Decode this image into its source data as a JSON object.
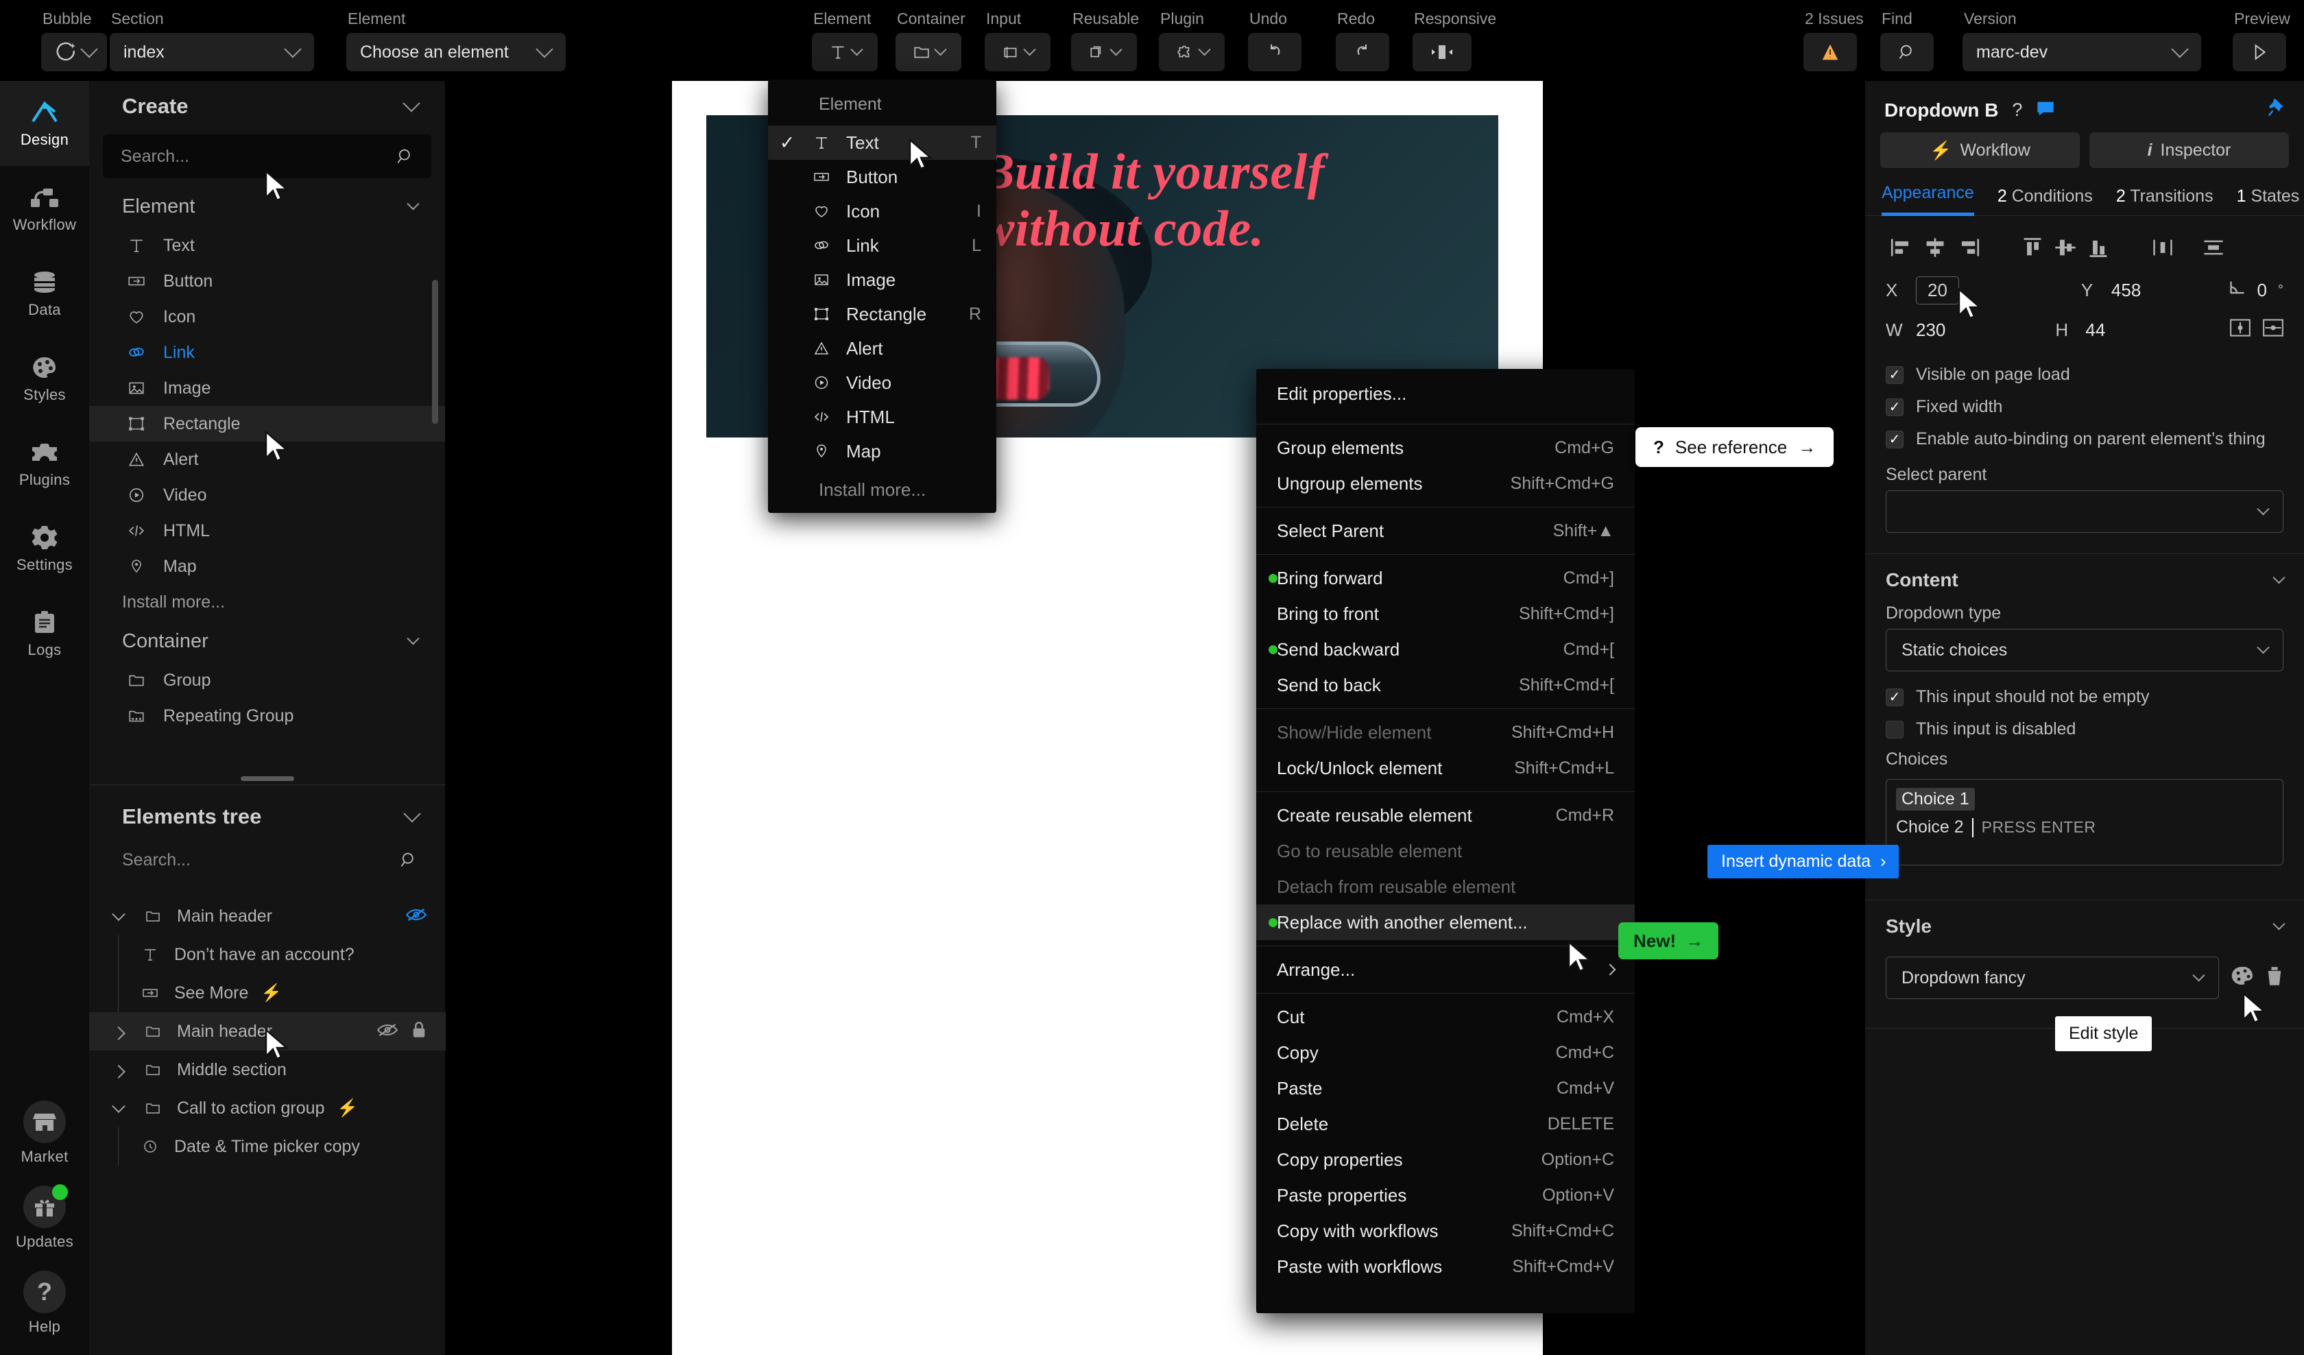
{
  "topbar": {
    "groups": [
      {
        "label": "Bubble",
        "type": "logo"
      },
      {
        "label": "Section",
        "type": "select",
        "value": "index"
      },
      {
        "label": "Element",
        "type": "select",
        "value": "Choose an element"
      },
      {
        "label": "Element",
        "type": "icon",
        "icon": "text-T-icon"
      },
      {
        "label": "Container",
        "type": "icon",
        "icon": "folder-icon"
      },
      {
        "label": "Input",
        "type": "icon",
        "icon": "input-box-icon"
      },
      {
        "label": "Reusable",
        "type": "icon",
        "icon": "stacked-layers-icon"
      },
      {
        "label": "Plugin",
        "type": "icon",
        "icon": "puzzle-icon"
      },
      {
        "label": "Undo",
        "type": "icon",
        "icon": "undo-arrow-icon"
      },
      {
        "label": "Redo",
        "type": "icon",
        "icon": "redo-arrow-icon"
      },
      {
        "label": "Responsive",
        "type": "icon",
        "icon": "responsive-icon"
      },
      {
        "label": "2 Issues",
        "type": "icon",
        "icon": "warning-triangle-icon"
      },
      {
        "label": "Find",
        "type": "icon",
        "icon": "magnifier-icon"
      },
      {
        "label": "Version",
        "type": "select",
        "value": "marc-dev"
      },
      {
        "label": "Preview",
        "type": "icon",
        "icon": "play-triangle-icon"
      }
    ]
  },
  "rail": {
    "items": [
      {
        "label": "Design",
        "icon": "compass-icon",
        "active": true
      },
      {
        "label": "Workflow",
        "icon": "workflow-icon",
        "active": false
      },
      {
        "label": "Data",
        "icon": "database-icon",
        "active": false
      },
      {
        "label": "Styles",
        "icon": "palette-icon",
        "active": false
      },
      {
        "label": "Plugins",
        "icon": "plugin-puzzle-icon",
        "active": false
      },
      {
        "label": "Settings",
        "icon": "gear-icon",
        "active": false
      },
      {
        "label": "Logs",
        "icon": "clipboard-icon",
        "active": false
      }
    ],
    "bottom": [
      {
        "label": "Market",
        "icon": "store-icon",
        "badge": false
      },
      {
        "label": "Updates",
        "icon": "gift-icon",
        "badge": true
      },
      {
        "label": "Help",
        "icon": "question-mark-icon",
        "badge": false
      }
    ]
  },
  "left_panel": {
    "create_title": "Create",
    "search_placeholder": "Search...",
    "element_group": "Element",
    "element_items": [
      {
        "label": "Text",
        "icon": "text-T-icon"
      },
      {
        "label": "Button",
        "icon": "button-icon"
      },
      {
        "label": "Icon",
        "icon": "heart-icon"
      },
      {
        "label": "Link",
        "icon": "link-icon",
        "highlight_blue": true
      },
      {
        "label": "Image",
        "icon": "image-icon"
      },
      {
        "label": "Rectangle",
        "icon": "rectangle-icon",
        "hovered": true
      },
      {
        "label": "Alert",
        "icon": "alert-triangle-icon"
      },
      {
        "label": "Video",
        "icon": "video-play-icon"
      },
      {
        "label": "HTML",
        "icon": "code-icon"
      },
      {
        "label": "Map",
        "icon": "map-pin-icon"
      }
    ],
    "install_more": "Install more...",
    "container_group": "Container",
    "container_items": [
      {
        "label": "Group",
        "icon": "folder-icon"
      },
      {
        "label": "Repeating Group",
        "icon": "repeating-folder-icon"
      }
    ],
    "tree_title": "Elements tree",
    "tree_search_placeholder": "Search...",
    "tree": [
      {
        "label": "Main header",
        "icon": "folder-icon",
        "expanded": true,
        "depth": 0,
        "eye": "hidden-blue",
        "lock": false,
        "bolt": false
      },
      {
        "label": "Don’t have an account?",
        "icon": "text-T-icon",
        "depth": 1,
        "bolt": false
      },
      {
        "label": "See More",
        "icon": "button-icon",
        "depth": 1,
        "bolt": true
      },
      {
        "label": "Main header",
        "icon": "folder-icon",
        "collapsed": true,
        "depth": 0,
        "eye": "hidden-grey",
        "lock": true,
        "selected": true,
        "bolt": false
      },
      {
        "label": "Middle section",
        "icon": "folder-icon",
        "collapsed": true,
        "depth": 0,
        "bolt": false
      },
      {
        "label": "Call to action group",
        "icon": "folder-icon",
        "expanded": true,
        "depth": 0,
        "bolt": true
      },
      {
        "label": "Date & Time picker copy",
        "icon": "clock-icon",
        "depth": 1,
        "bolt": false
      }
    ]
  },
  "canvas": {
    "hero_heading": "Build it yourself without code."
  },
  "element_menu": {
    "title": "Element",
    "items": [
      {
        "label": "Text",
        "key": "T",
        "icon": "text-T-icon",
        "checked": true
      },
      {
        "label": "Button",
        "key": "",
        "icon": "button-icon"
      },
      {
        "label": "Icon",
        "key": "I",
        "icon": "heart-icon"
      },
      {
        "label": "Link",
        "key": "L",
        "icon": "link-icon"
      },
      {
        "label": "Image",
        "key": "",
        "icon": "image-icon"
      },
      {
        "label": "Rectangle",
        "key": "R",
        "icon": "rectangle-icon"
      },
      {
        "label": "Alert",
        "key": "",
        "icon": "alert-triangle-icon"
      },
      {
        "label": "Video",
        "key": "",
        "icon": "video-play-icon"
      },
      {
        "label": "HTML",
        "key": "",
        "icon": "code-icon"
      },
      {
        "label": "Map",
        "key": "",
        "icon": "map-pin-icon"
      }
    ],
    "install_more": "Install more..."
  },
  "context_menu": {
    "items": [
      {
        "label": "Edit properties...",
        "key": "",
        "sep_after": true
      },
      {
        "label": "Group elements",
        "key": "Cmd+G"
      },
      {
        "label": "Ungroup elements",
        "key": "Shift+Cmd+G",
        "sep_after": true
      },
      {
        "label": "Select Parent",
        "key": "Shift+▲",
        "sep_after": true
      },
      {
        "label": "Bring forward",
        "key": "Cmd+]",
        "dot": true
      },
      {
        "label": "Bring to front",
        "key": "Shift+Cmd+]"
      },
      {
        "label": "Send backward",
        "key": "Cmd+[",
        "dot": true
      },
      {
        "label": "Send to back",
        "key": "Shift+Cmd+[",
        "sep_after": true
      },
      {
        "label": "Show/Hide element",
        "key": "Shift+Cmd+H",
        "disabled": true
      },
      {
        "label": "Lock/Unlock element",
        "key": "Shift+Cmd+L",
        "sep_after": true
      },
      {
        "label": "Create reusable element",
        "key": "Cmd+R"
      },
      {
        "label": "Go to reusable element",
        "key": "",
        "disabled": true
      },
      {
        "label": "Detach from reusable element",
        "key": "",
        "disabled": true
      },
      {
        "label": "Replace with another element...",
        "key": "",
        "dot": true,
        "highlight": true,
        "sep_after": true
      },
      {
        "label": "Arrange...",
        "key": "",
        "submenu": true,
        "sep_after": true
      },
      {
        "label": "Cut",
        "key": "Cmd+X"
      },
      {
        "label": "Copy",
        "key": "Cmd+C"
      },
      {
        "label": "Paste",
        "key": "Cmd+V"
      },
      {
        "label": "Delete",
        "key": "DELETE"
      },
      {
        "label": "Copy properties",
        "key": "Option+C"
      },
      {
        "label": "Paste properties",
        "key": "Option+V"
      },
      {
        "label": "Copy with workflows",
        "key": "Shift+Cmd+C"
      },
      {
        "label": "Paste with workflows",
        "key": "Shift+Cmd+V"
      }
    ],
    "see_reference": "See reference",
    "new_badge": "New!"
  },
  "inspector": {
    "title": "Dropdown B",
    "tab_workflow": "Workflow",
    "tab_inspector": "Inspector",
    "subtabs": [
      {
        "count": "",
        "label": "Appearance",
        "active": true
      },
      {
        "count": "2",
        "label": "Conditions"
      },
      {
        "count": "2",
        "label": "Transitions"
      },
      {
        "count": "1",
        "label": "States"
      }
    ],
    "x_label": "X",
    "x_value": "20",
    "y_label": "Y",
    "y_value": "458",
    "rot_value": "0",
    "rot_unit": "°",
    "w_label": "W",
    "w_value": "230",
    "h_label": "H",
    "h_value": "44",
    "checks": [
      {
        "label": "Visible on page load",
        "checked": true
      },
      {
        "label": "Fixed width",
        "checked": true
      },
      {
        "label": "Enable auto-binding on parent element’s thing",
        "checked": true
      }
    ],
    "select_parent_label": "Select parent",
    "select_parent_value": "",
    "content_title": "Content",
    "dropdown_type_label": "Dropdown type",
    "dropdown_type_value": "Static choices",
    "content_checks": [
      {
        "label": "This input should not be empty",
        "checked": true
      },
      {
        "label": "This input is disabled",
        "checked": false
      }
    ],
    "choices_label": "Choices",
    "choice_1": "Choice 1",
    "choice_2": "Choice 2",
    "press_enter": "PRESS ENTER",
    "style_title": "Style",
    "style_value": "Dropdown fancy",
    "insert_dynamic_data": "Insert dynamic data",
    "edit_style_tooltip": "Edit style"
  }
}
